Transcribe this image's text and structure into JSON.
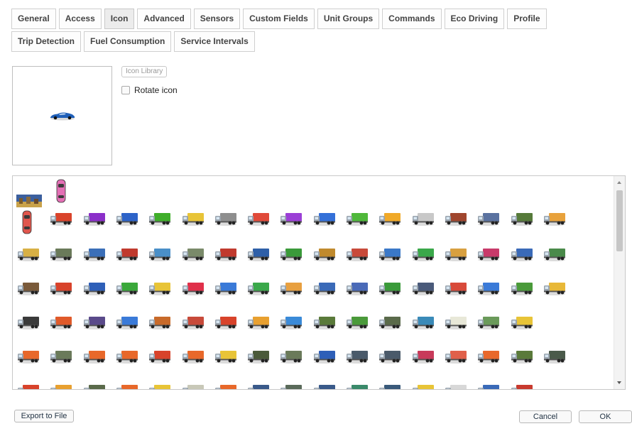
{
  "tabs": {
    "row1": [
      "General",
      "Access",
      "Icon",
      "Advanced",
      "Sensors",
      "Custom Fields",
      "Unit Groups",
      "Commands",
      "Eco Driving",
      "Profile"
    ],
    "row2": [
      "Trip Detection",
      "Fuel Consumption",
      "Service Intervals"
    ],
    "active": "Icon"
  },
  "icon_panel": {
    "library_button": "Icon Library",
    "rotate_label": "Rotate icon",
    "rotate_checked": false,
    "selected_icon": "blue-sports-car-icon"
  },
  "gallery": {
    "rows": [
      [
        "#3a5ca8",
        "#e46fb5"
      ],
      [
        "#e0564d",
        "#d9432b",
        "#8b2fc9",
        "#2d63c8",
        "#3fae2a",
        "#e8c437",
        "#8e8e8e",
        "#e04a3a",
        "#9b3fd6",
        "#3470d8",
        "#4fb83a",
        "#f0a928",
        "#c8c8c8",
        "#a0462e",
        "#5a72a0",
        "#567a3a",
        "#e8a23c"
      ],
      [
        "#d8b045",
        "#6a7a5a",
        "#3b6fb8",
        "#c03a2e",
        "#4a8fc8",
        "#7a8a6a",
        "#c03a2e",
        "#2e5fa8",
        "#3a9a3a",
        "#c08a2e",
        "#c84a3a",
        "#3a78c8",
        "#3aa84a",
        "#d8a040",
        "#c83a6a",
        "#3a6ab8",
        "#4a8a4a"
      ],
      [
        "#7a5a3a",
        "#d8432b",
        "#2e5fb8",
        "#3aa83a",
        "#e8c437",
        "#e0304a",
        "#3a7ad8",
        "#3aa84a",
        "#e8a040",
        "#3a6ab8",
        "#4a6ab8",
        "#3a9a3a",
        "#4a5a7a",
        "#d84a3a",
        "#3a7ad8",
        "#4a9a3a",
        "#e8b838"
      ],
      [
        "#3a3a3a",
        "#e05a2a",
        "#5a4a8a",
        "#3a7ad8",
        "#c86a2a",
        "#c84a3a",
        "#d8432b",
        "#e8a030",
        "#3a8ad8",
        "#5a7a3a",
        "#4a9a3a",
        "#5a6a4a",
        "#3a8ab8",
        "#e8e8d8",
        "#6a9a5a",
        "#e8c437"
      ],
      [
        "#e8682a",
        "#6a7a5a",
        "#e8682a",
        "#e8682a",
        "#d8432b",
        "#e8682a",
        "#e8c437",
        "#4a5a3a",
        "#6a7a5a",
        "#2e5fb8",
        "#4a5a6a",
        "#4a5a6a",
        "#c83a5a",
        "#e0604a",
        "#e8682a",
        "#5a7a3a",
        "#4a5a4a"
      ],
      [
        "#d8432b",
        "#e8a030",
        "#5a6a4a",
        "#e8682a",
        "#e8c437",
        "#c8c8b8",
        "#e8682a",
        "#3a5a8a",
        "#5a6a5a",
        "#3a5a8a",
        "#3a8a6a",
        "#3a5a7a",
        "#e8c437",
        "#d8d8d8",
        "#3a6ab8",
        "#c83a2e"
      ]
    ]
  },
  "footer": {
    "export_label": "Export to File",
    "cancel_label": "Cancel",
    "ok_label": "OK"
  }
}
